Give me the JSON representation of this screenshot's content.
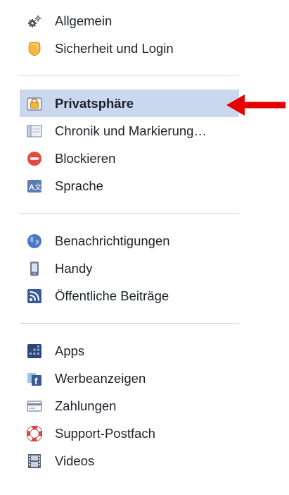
{
  "sidebar": {
    "groups": [
      {
        "items": [
          {
            "label": "Allgemein",
            "icon": "gears-icon"
          },
          {
            "label": "Sicherheit und Login",
            "icon": "security-badge-icon"
          }
        ]
      },
      {
        "items": [
          {
            "label": "Privatsphäre",
            "icon": "privacy-lock-icon",
            "selected": true
          },
          {
            "label": "Chronik und Markierung…",
            "icon": "timeline-icon"
          },
          {
            "label": "Blockieren",
            "icon": "block-icon"
          },
          {
            "label": "Sprache",
            "icon": "language-icon"
          }
        ]
      },
      {
        "items": [
          {
            "label": "Benachrichtigungen",
            "icon": "globe-notifications-icon"
          },
          {
            "label": "Handy",
            "icon": "mobile-phone-icon"
          },
          {
            "label": "Öffentliche Beiträge",
            "icon": "rss-feed-icon"
          }
        ]
      },
      {
        "items": [
          {
            "label": "Apps",
            "icon": "apps-grid-icon"
          },
          {
            "label": "Werbeanzeigen",
            "icon": "ads-icon"
          },
          {
            "label": "Zahlungen",
            "icon": "credit-card-icon"
          },
          {
            "label": "Support-Postfach",
            "icon": "lifebuoy-icon"
          },
          {
            "label": "Videos",
            "icon": "film-strip-icon"
          }
        ]
      }
    ]
  },
  "annotation": {
    "arrow_color": "#e60000",
    "icon": "red-arrow-icon"
  },
  "colors": {
    "selected_bg": "#c9d8ee",
    "divider": "#d3d6db",
    "text": "#1d2129"
  }
}
